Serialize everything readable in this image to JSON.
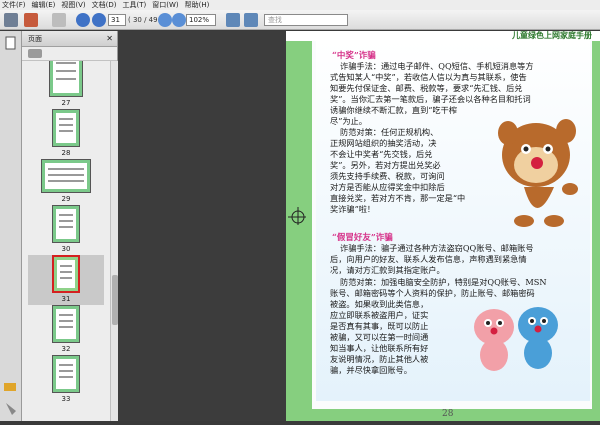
{
  "menu": [
    "文件(F)",
    "编辑(E)",
    "视图(V)",
    "文档(D)",
    "工具(T)",
    "窗口(W)",
    "帮助(H)"
  ],
  "toolbar": {
    "page_current": "31",
    "page_total": "( 30 / 49 )",
    "zoom": "102%",
    "search_placeholder": "查找"
  },
  "panel": {
    "title": "页面",
    "thumbnails": [
      {
        "label": "27"
      },
      {
        "label": "28"
      },
      {
        "label": "29"
      },
      {
        "label": "30"
      },
      {
        "label": "31",
        "selected": true
      },
      {
        "label": "32"
      },
      {
        "label": "33"
      }
    ]
  },
  "document": {
    "header": "儿童绿色上网家庭手册",
    "page_number": "28",
    "section1_title": "“中奖”诈骗",
    "section1_lines": [
      "诈骗手法：通过电子邮件、QQ短信、手机短消息等方",
      "式告知某人“中奖”，若收信人信以为真与其联系，使告",
      "知要先付保证金、邮费、税款等，要求“先汇钱、后兑",
      "奖”。当你汇去第一笔款后，骗子还会以各种名目和托词",
      "诱骗你继续不断汇款，直到“吃干榨",
      "尽”为止。",
      "防范对策：任何正规机构、",
      "正规网站组织的抽奖活动，决",
      "不会让中奖者“先交钱，后兑",
      "奖”。另外，若对方提出兑奖必",
      "须先支持手续费、税款，可询问",
      "对方是否能从应得奖金中扣除后",
      "直接兑奖，若对方不肯，那一定是“中",
      "奖诈骗”啦！"
    ],
    "section2_title": "“假冒好友”诈骗",
    "section2_lines": [
      "诈骗手法：骗子通过各种方法盗窃QQ账号、邮箱账号",
      "后，向用户的好友、联系人发布信息，声称遇到紧急情",
      "况，请对方汇款到其指定账户。",
      "防范对策：加强电脑安全防护，特别是对QQ账号、MSN",
      "账号、邮箱密码等个人资料的保护，防止账号、邮箱密码",
      "被盗。如果收到此类信息，",
      "应立即联系被盗用户，证实",
      "是否真有其事，既可以防止",
      "被骗，又可以在第一时间通",
      "知当事人，让他联系所有好",
      "友说明情况，防止其他人被",
      "骗，并尽快拿回账号。"
    ]
  },
  "colors": {
    "accent_green": "#86cf7f",
    "title_pink": "#d6338a",
    "selection_red": "#d42020"
  }
}
